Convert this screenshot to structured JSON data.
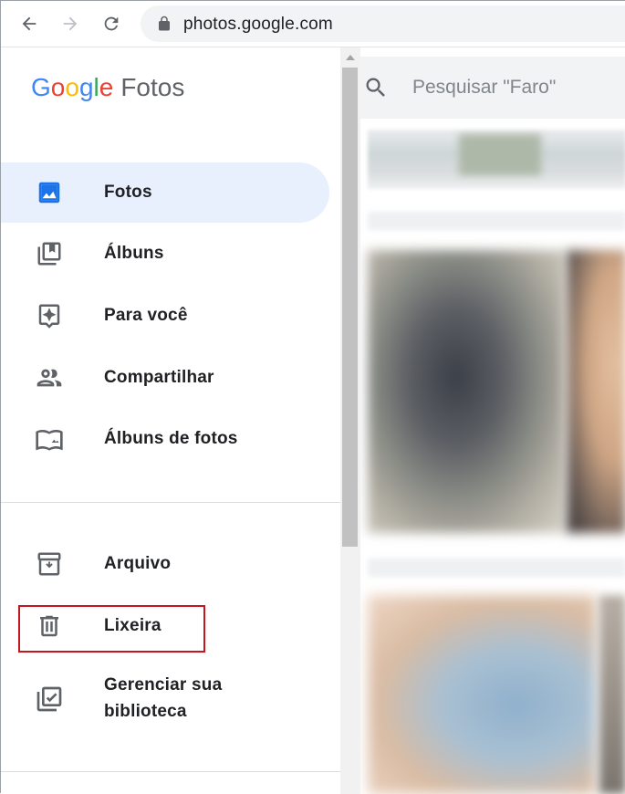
{
  "browser": {
    "url": "photos.google.com",
    "icons": {
      "back": "arrow-left-icon",
      "forward": "arrow-right-icon",
      "reload": "reload-icon",
      "lock": "lock-icon"
    }
  },
  "app": {
    "logo_google": [
      "G",
      "o",
      "o",
      "g",
      "l",
      "e"
    ],
    "logo_product": "Fotos",
    "brand_colors": {
      "blue": "#4285f4",
      "red": "#ea4335",
      "yellow": "#fbbc05",
      "green": "#34a853"
    }
  },
  "sidebar": {
    "items": [
      {
        "label": "Fotos",
        "icon": "photo-icon",
        "active": true
      },
      {
        "label": "Álbuns",
        "icon": "albums-icon",
        "active": false
      },
      {
        "label": "Para você",
        "icon": "assistant-icon",
        "active": false
      },
      {
        "label": "Compartilhar",
        "icon": "people-icon",
        "active": false
      },
      {
        "label": "Álbuns de fotos",
        "icon": "photo-book-icon",
        "active": false
      }
    ],
    "secondary_items": [
      {
        "label": "Arquivo",
        "icon": "archive-icon"
      },
      {
        "label": "Lixeira",
        "icon": "trash-icon",
        "highlighted": true
      },
      {
        "label_line1": "Gerenciar sua",
        "label_line2": "biblioteca",
        "icon": "library-check-icon"
      }
    ],
    "active_color": "#1a73e8",
    "highlight_color": "#c5161d"
  },
  "search": {
    "placeholder": "Pesquisar \"Faro\"",
    "icon": "search-icon"
  }
}
